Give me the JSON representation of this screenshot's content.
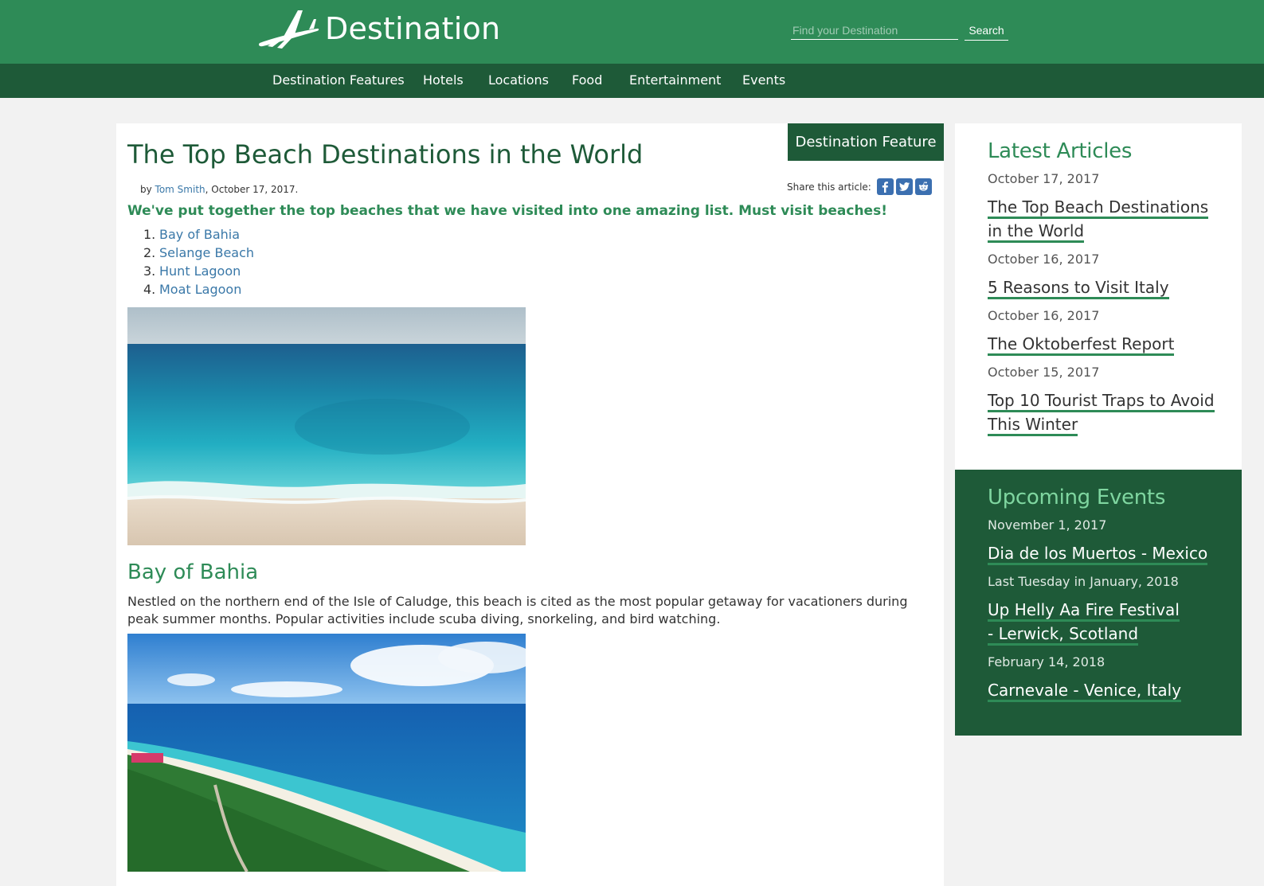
{
  "header": {
    "site_name": "Destination",
    "logo_icon": "airplane-icon",
    "search_placeholder": "Find your Destination",
    "search_button": "Search",
    "colors": {
      "primary": "#2e8b57",
      "dark": "#1e5a38",
      "link": "#3a78a8"
    }
  },
  "nav": {
    "items": [
      "Destination Features",
      "Hotels",
      "Locations",
      "Food",
      "Entertainment",
      "Events"
    ]
  },
  "article": {
    "tag": "Destination Feature",
    "title": "The Top Beach Destinations in the World",
    "byline_prefix": "by",
    "author": "Tom Smith",
    "date": ", October 17, 2017.",
    "share_label": "Share this article:",
    "share_icons": [
      "facebook-icon",
      "twitter-icon",
      "reddit-icon"
    ],
    "lede": "We've put together the top beaches that we have visited into one amazing list. Must visit beaches!",
    "toc": [
      {
        "num": "1.",
        "label": "Bay of Bahia"
      },
      {
        "num": "2.",
        "label": "Selange Beach"
      },
      {
        "num": "3.",
        "label": "Hunt Lagoon"
      },
      {
        "num": "4.",
        "label": "Moat Lagoon"
      }
    ],
    "section": {
      "heading": "Bay of Bahia",
      "body": "Nestled on the northern end of the Isle of Caludge, this beach is cited as the most popular getaway for vacationers during peak summer months. Popular activities include scuba diving, snorkeling, and bird watching."
    }
  },
  "sidebar": {
    "latest": {
      "heading": "Latest Articles",
      "items": [
        {
          "date": "October 17, 2017",
          "title": "The Top Beach Destinations in the World"
        },
        {
          "date": "October 16, 2017",
          "title": "5 Reasons to Visit Italy"
        },
        {
          "date": "October 16, 2017",
          "title": "The Oktoberfest Report"
        },
        {
          "date": "October 15, 2017",
          "title": "Top 10 Tourist Traps to Avoid This Winter"
        }
      ]
    },
    "events": {
      "heading": "Upcoming Events",
      "items": [
        {
          "date": "November 1, 2017",
          "title": "Dia de los Muertos - Mexico"
        },
        {
          "date": "Last Tuesday in January, 2018",
          "title": "Up Helly Aa Fire Festival - Lerwick, Scotland"
        },
        {
          "date": "February 14, 2018",
          "title": "Carnevale - Venice, Italy"
        }
      ]
    }
  }
}
